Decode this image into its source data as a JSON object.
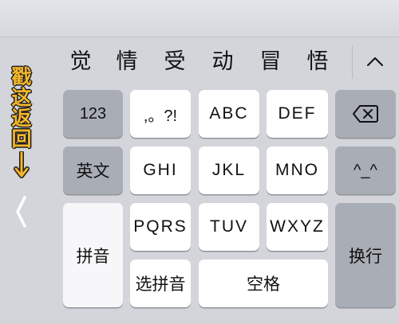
{
  "candidates": [
    "觉",
    "情",
    "受",
    "动",
    "冒",
    "悟"
  ],
  "annotation": {
    "chars": [
      "戳",
      "这",
      "返",
      "回"
    ]
  },
  "icons": {
    "collapse": "chevron-up-icon",
    "delete": "backspace-icon",
    "arrow": "down-arrow-icon",
    "back": "chevron-left-icon"
  },
  "keys": {
    "numbers": "123",
    "punct": ",。?!",
    "abc": "ABC",
    "def": "DEF",
    "english": "英文",
    "ghi": "GHI",
    "jkl": "JKL",
    "mno": "MNO",
    "emoticon": "^_^",
    "pinyin": "拼音",
    "pqrs": "PQRS",
    "tuv": "TUV",
    "wxyz": "WXYZ",
    "newline": "换行",
    "select_pinyin": "选拼音",
    "space": "空格"
  },
  "colors": {
    "annotation": "#f3b52a",
    "keyboard_bg": "#d3d5db",
    "dark_key": "#a9adb6"
  }
}
